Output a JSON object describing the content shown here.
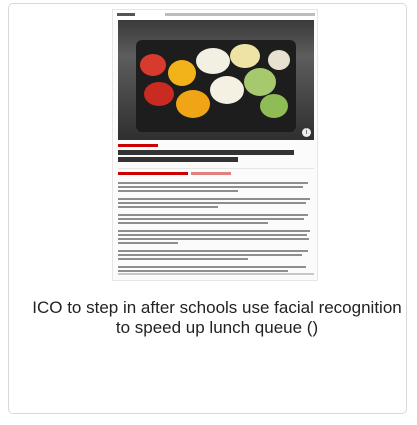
{
  "card": {
    "caption": "ICO to step in after schools use facial recognition to speed up lunch queue ()"
  },
  "thumbnail": {
    "article_headline": "ICO to step in after schools use facial recognition to speed up lunch queue",
    "image_alt": "school lunch fruit tray"
  },
  "colors": {
    "accent": "#cc0000",
    "border": "#d9d9d9"
  }
}
